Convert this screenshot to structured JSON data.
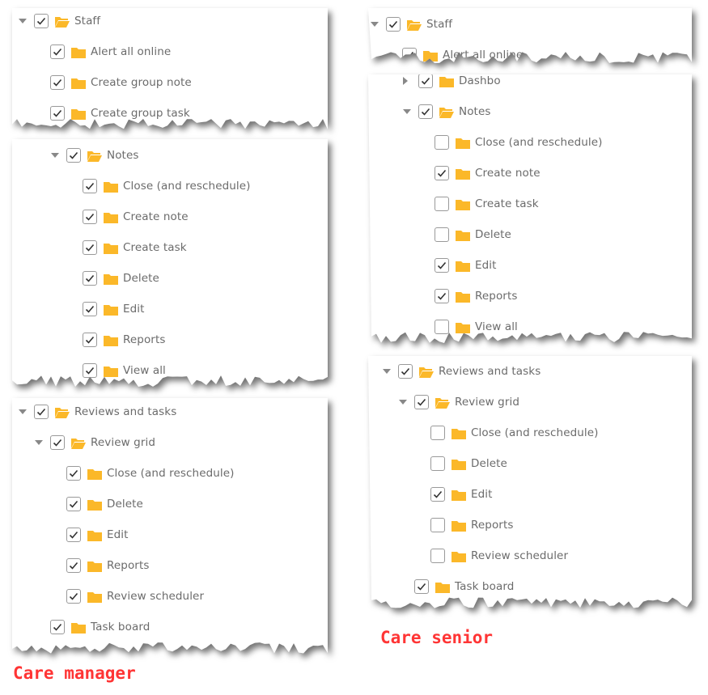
{
  "colors": {
    "folder": "#fbb829",
    "caption": "#ff3535",
    "text": "#6b6b6b"
  },
  "captions": {
    "left": "Care manager",
    "right": "Care senior"
  },
  "panels": [
    {
      "id": "left-staff",
      "rows": [
        {
          "label": "Staff",
          "level": 0,
          "arrow": "down",
          "open": true,
          "checked": true
        },
        {
          "label": "Alert all online",
          "level": 1,
          "checked": true
        },
        {
          "label": "Create group note",
          "level": 1,
          "checked": true
        },
        {
          "label": "Create group task",
          "level": 1,
          "checked": true
        }
      ]
    },
    {
      "id": "left-notes",
      "rows": [
        {
          "label": "Notes",
          "level": 2,
          "arrow": "down",
          "open": true,
          "checked": true
        },
        {
          "label": "Close (and reschedule)",
          "level": 3,
          "checked": true
        },
        {
          "label": "Create note",
          "level": 3,
          "checked": true
        },
        {
          "label": "Create task",
          "level": 3,
          "checked": true
        },
        {
          "label": "Delete",
          "level": 3,
          "checked": true
        },
        {
          "label": "Edit",
          "level": 3,
          "checked": true
        },
        {
          "label": "Reports",
          "level": 3,
          "checked": true
        },
        {
          "label": "View all",
          "level": 3,
          "checked": true
        }
      ]
    },
    {
      "id": "left-reviews",
      "rows": [
        {
          "label": "Reviews and tasks",
          "level": 0,
          "arrow": "down",
          "open": true,
          "checked": true
        },
        {
          "label": "Review grid",
          "level": 1,
          "arrow": "down",
          "open": true,
          "checked": true
        },
        {
          "label": "Close (and reschedule)",
          "level": 2,
          "checked": true
        },
        {
          "label": "Delete",
          "level": 2,
          "checked": true
        },
        {
          "label": "Edit",
          "level": 2,
          "checked": true
        },
        {
          "label": "Reports",
          "level": 2,
          "checked": true
        },
        {
          "label": "Review scheduler",
          "level": 2,
          "checked": true
        },
        {
          "label": "Task board",
          "level": 1,
          "checked": true
        }
      ]
    },
    {
      "id": "right-staff",
      "rows": [
        {
          "label": "Staff",
          "level": 0,
          "arrow": "down",
          "open": true,
          "checked": true
        },
        {
          "label": "Alert all online",
          "level": 1,
          "checked": true
        }
      ]
    },
    {
      "id": "right-notes",
      "rows": [
        {
          "label": "Dashbo",
          "level": 2,
          "arrow": "right",
          "checked": true
        },
        {
          "label": "Notes",
          "level": 2,
          "arrow": "down",
          "open": true,
          "checked": true
        },
        {
          "label": "Close (and reschedule)",
          "level": 3,
          "checked": false
        },
        {
          "label": "Create note",
          "level": 3,
          "checked": true
        },
        {
          "label": "Create task",
          "level": 3,
          "checked": false
        },
        {
          "label": "Delete",
          "level": 3,
          "checked": false
        },
        {
          "label": "Edit",
          "level": 3,
          "checked": true
        },
        {
          "label": "Reports",
          "level": 3,
          "checked": true
        },
        {
          "label": "View all",
          "level": 3,
          "checked": false
        }
      ]
    },
    {
      "id": "right-reviews",
      "rows": [
        {
          "label": "Reviews and tasks",
          "level": 0,
          "arrow": "down",
          "open": true,
          "checked": true
        },
        {
          "label": "Review grid",
          "level": 1,
          "arrow": "down",
          "open": true,
          "checked": true
        },
        {
          "label": "Close (and reschedule)",
          "level": 2,
          "checked": false
        },
        {
          "label": "Delete",
          "level": 2,
          "checked": false
        },
        {
          "label": "Edit",
          "level": 2,
          "checked": true
        },
        {
          "label": "Reports",
          "level": 2,
          "checked": false
        },
        {
          "label": "Review scheduler",
          "level": 2,
          "checked": false
        },
        {
          "label": "Task board",
          "level": 1,
          "checked": true
        }
      ]
    }
  ]
}
